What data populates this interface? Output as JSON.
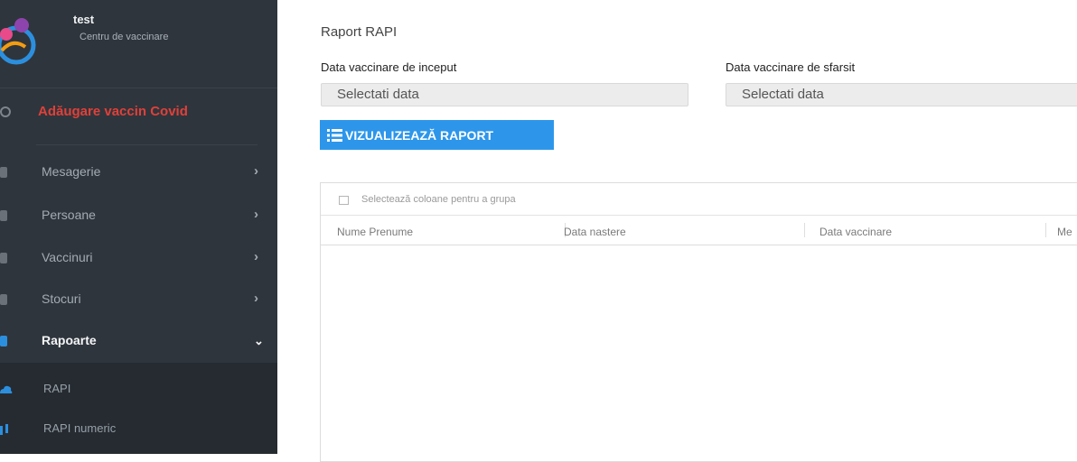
{
  "sidebar": {
    "brand": {
      "title": "test",
      "subtitle": "Centru de vaccinare"
    },
    "add_covid": {
      "label": "Adăugare vaccin Covid",
      "color": "#e0403a"
    },
    "items": [
      {
        "label": "Mesagerie",
        "icon": "envelope-icon",
        "expanded": false
      },
      {
        "label": "Persoane",
        "icon": "users-icon",
        "expanded": false
      },
      {
        "label": "Vaccinuri",
        "icon": "syringe-icon",
        "expanded": false
      },
      {
        "label": "Stocuri",
        "icon": "syringe-icon",
        "expanded": false
      },
      {
        "label": "Rapoarte",
        "icon": "report-icon",
        "expanded": true
      }
    ],
    "submenu": [
      {
        "label": "RAPI",
        "icon": "cloud-icon",
        "icon_color": "#2c8fde"
      },
      {
        "label": "RAPI numeric",
        "icon": "sort-icon",
        "icon_color": "#2c8fde"
      }
    ]
  },
  "main": {
    "title": "Raport RAPI",
    "start_date": {
      "label": "Data vaccinare de inceput",
      "placeholder": "Selectati data"
    },
    "end_date": {
      "label": "Data vaccinare de sfarsit",
      "placeholder": "Selectati data"
    },
    "view_button": {
      "label": "VIZUALIZEAZĂ RAPORT",
      "icon": "list-icon",
      "color": "#2d96ea"
    },
    "grid": {
      "group_panel_text": "Selectează coloane pentru a grupa",
      "columns": [
        "Nume Prenume",
        "Data nastere",
        "Data vaccinare",
        "Me"
      ]
    }
  }
}
